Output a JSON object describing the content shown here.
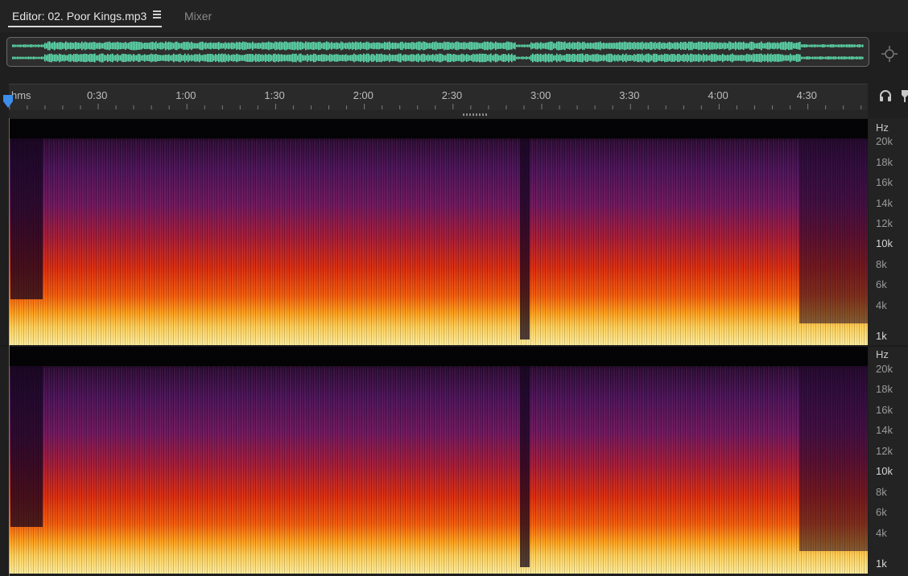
{
  "tabs": {
    "editor_label": "Editor: 02. Poor Kings.mp3",
    "mixer_label": "Mixer"
  },
  "ruler": {
    "unit": "hms",
    "ticks": [
      "0:30",
      "1:00",
      "1:30",
      "2:00",
      "2:30",
      "3:00",
      "3:30",
      "4:00",
      "4:30"
    ]
  },
  "hz_axis": {
    "unit": "Hz",
    "labels": [
      "20k",
      "18k",
      "16k",
      "14k",
      "12k",
      "10k",
      "8k",
      "6k",
      "4k",
      "1k"
    ]
  },
  "colors": {
    "waveform": "#5ee0b0",
    "playhead": "#3d8ee8"
  },
  "icons": {
    "zoom": "zoom-navigator-icon",
    "headphones": "headphones-icon",
    "marker": "marker-pin-icon",
    "menu": "hamburger-menu-icon"
  }
}
